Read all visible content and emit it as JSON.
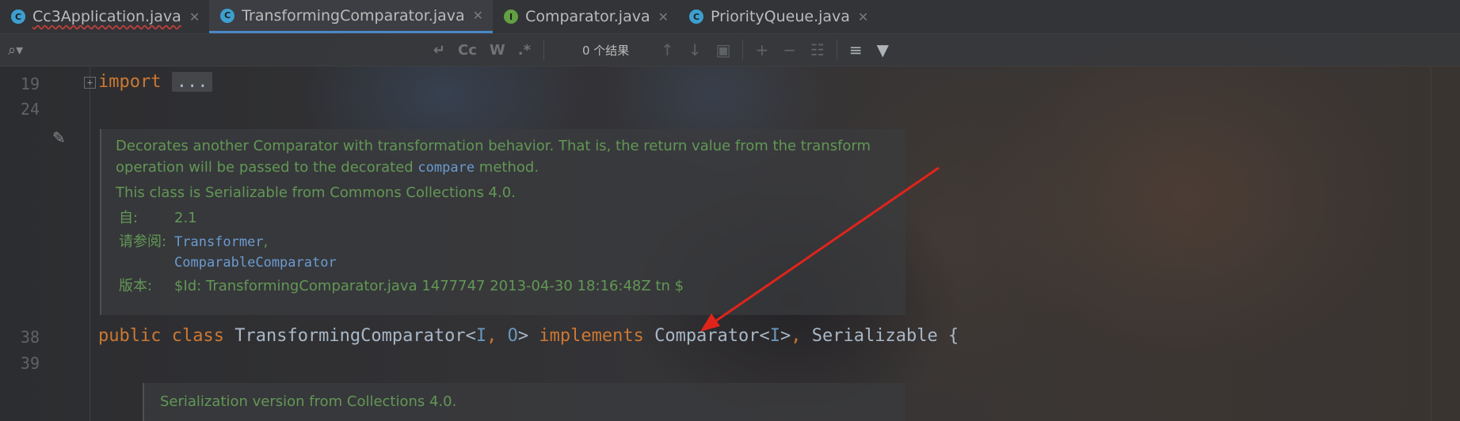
{
  "tabs": [
    {
      "label": "Cc3Application.java",
      "icon": "app-class-icon",
      "active": false
    },
    {
      "label": "TransformingComparator.java",
      "icon": "class-icon",
      "active": true
    },
    {
      "label": "Comparator.java",
      "icon": "interface-icon",
      "active": false
    },
    {
      "label": "PriorityQueue.java",
      "icon": "class-icon",
      "active": false
    }
  ],
  "tab_icon_letters": {
    "class": "C",
    "interface": "I"
  },
  "find": {
    "results": "0 个结果",
    "opt_case": "Cc",
    "opt_word": "W",
    "opt_regex": ".*"
  },
  "gutter": {
    "l19": "19",
    "l24": "24",
    "l38": "38",
    "l39": "39"
  },
  "code": {
    "import_kw": "import",
    "import_folded": "...",
    "decl": {
      "public": "public",
      "class": "class",
      "name": "TransformingComparator",
      "lt": "<",
      "tI": "I",
      "comma": ", ",
      "tO": "O",
      "gt": ">",
      "implements": "implements",
      "iface": "Comparator",
      "lt2": "<",
      "tI2": "I",
      "gt2": ">",
      "comma2": ", ",
      "serial": "Serializable",
      "brace": "{"
    }
  },
  "doc1": {
    "line1": "Decorates another Comparator with transformation behavior. That is, the return value from the transform",
    "line2_pre": "operation will be passed to the decorated ",
    "line2_code": "compare",
    "line2_post": " method.",
    "serializable": "This class is Serializable from Commons Collections 4.0.",
    "since_key": "自:",
    "since_val": "2.1",
    "see_key": "请参阅:",
    "see_1": "Transformer",
    "see_1_suffix": ",",
    "see_2": "ComparableComparator",
    "version_key": "版本:",
    "version_val": "$Id: TransformingComparator.java 1477747 2013-04-30 18:16:48Z tn $"
  },
  "doc2": {
    "text": "Serialization version from Collections 4.0."
  },
  "colors": {
    "keyword": "#cc7832",
    "doc_text": "#629755",
    "code_ref": "#6b9bd1",
    "arrow": "#e0241b",
    "active_tab_underline": "#4a88c7"
  }
}
